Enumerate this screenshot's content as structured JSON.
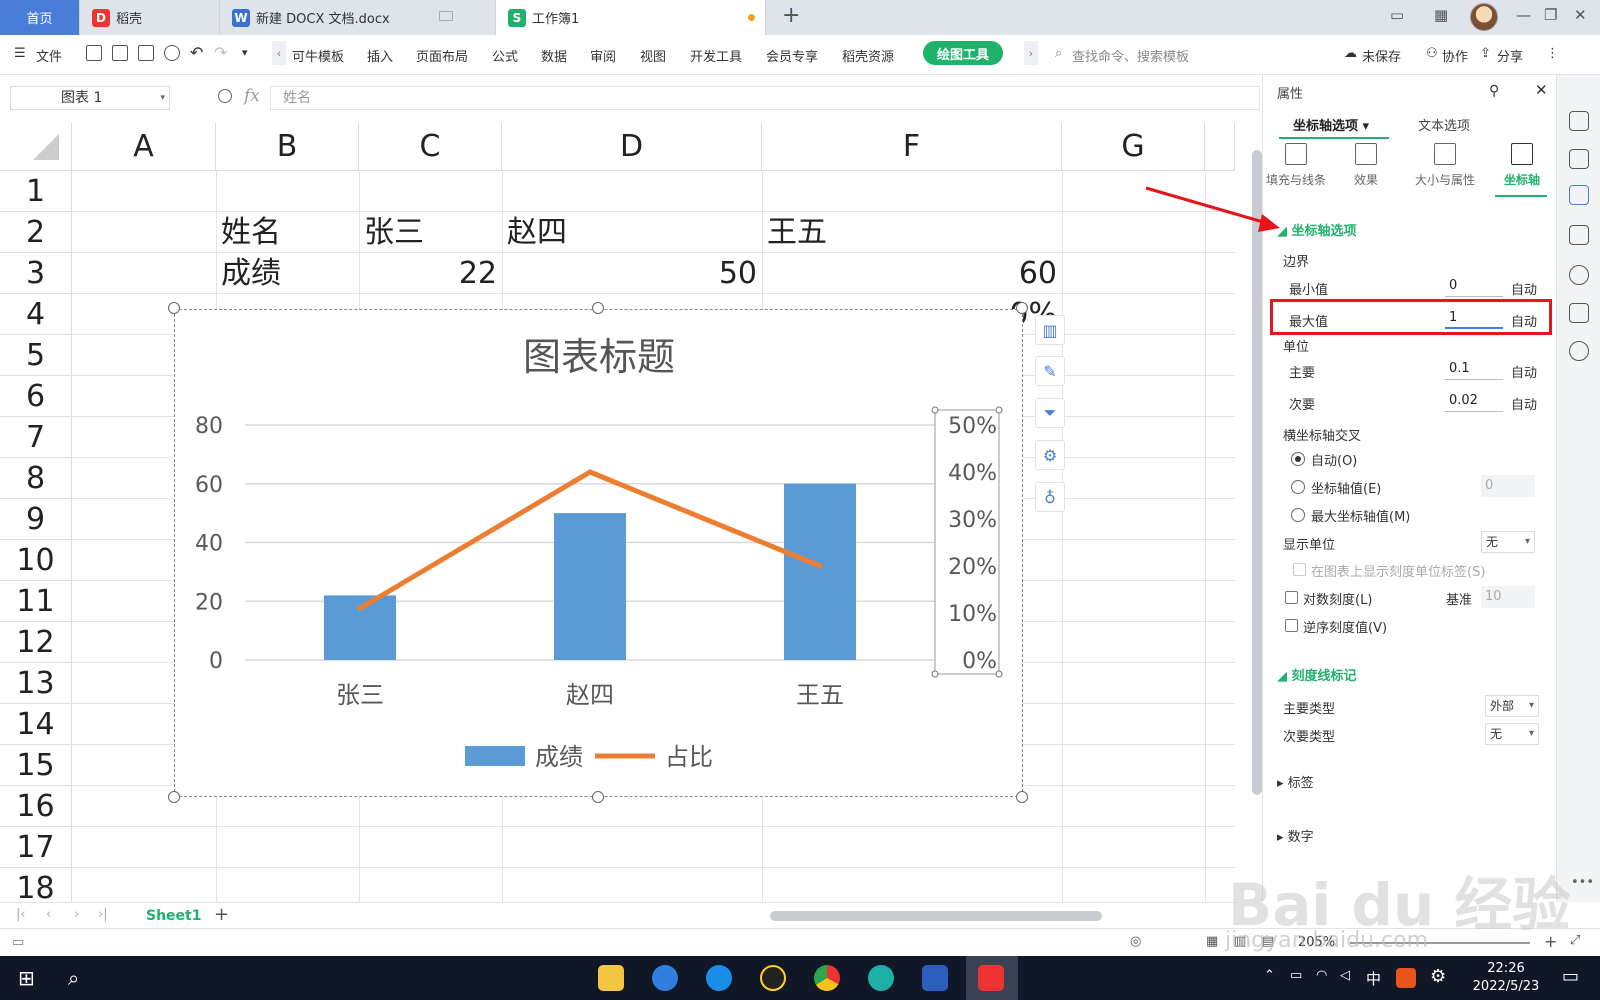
{
  "tabs": {
    "home": "首页",
    "daoke": "稻壳",
    "doc": "新建 DOCX 文档.docx",
    "workbook": "工作簿1"
  },
  "menu": {
    "file": "文件",
    "items": [
      "可牛模板",
      "插入",
      "页面布局",
      "公式",
      "数据",
      "审阅",
      "视图",
      "开发工具",
      "会员专享",
      "稻壳资源"
    ],
    "draw_tools": "绘图工具",
    "search": "查找命令、搜索模板",
    "unsaved": "未保存",
    "collab": "协作",
    "share": "分享"
  },
  "formula": {
    "namebox": "图表 1",
    "fx": "fx",
    "content": "姓名"
  },
  "grid": {
    "columns": [
      "A",
      "B",
      "C",
      "D",
      "F",
      "G"
    ],
    "rows": [
      "1",
      "2",
      "3",
      "4",
      "5",
      "6",
      "7",
      "8",
      "9",
      "10",
      "11",
      "12",
      "13",
      "14",
      "15",
      "16",
      "17",
      "18"
    ],
    "cells": {
      "b2": "姓名",
      "c2": "张三",
      "d2": "赵四",
      "f2": "王五",
      "b3": "成绩",
      "c3": "22",
      "d3": "50",
      "f3": "60",
      "f4_partial": "0%"
    }
  },
  "chart_data": {
    "type": "bar",
    "title": "图表标题",
    "categories": [
      "张三",
      "赵四",
      "王五"
    ],
    "series": [
      {
        "name": "成绩",
        "type": "bar",
        "axis": "left",
        "values": [
          22,
          50,
          60
        ],
        "color": "#5b9bd5"
      },
      {
        "name": "占比",
        "type": "line",
        "axis": "right",
        "values": [
          0.11,
          0.4,
          0.2
        ],
        "color": "#ed7d31"
      }
    ],
    "y_left": {
      "ticks": [
        "80",
        "60",
        "40",
        "20",
        "0"
      ],
      "ylim": [
        0,
        80
      ]
    },
    "y_right": {
      "ticks": [
        "50%",
        "40%",
        "30%",
        "20%",
        "10%",
        "0%"
      ],
      "ylim": [
        0,
        0.5
      ]
    },
    "legend": "bottom",
    "grid": true
  },
  "props": {
    "title": "属性",
    "tab_axis": "坐标轴选项",
    "tab_text": "文本选项",
    "icon_tabs": [
      "填充与线条",
      "效果",
      "大小与属性",
      "坐标轴"
    ],
    "section_axis": "坐标轴选项",
    "bounds": "边界",
    "min_label": "最小值",
    "min_value": "0",
    "max_label": "最大值",
    "max_value": "1",
    "auto": "自动",
    "unit": "单位",
    "major_label": "主要",
    "major_value": "0.1",
    "minor_label": "次要",
    "minor_value": "0.02",
    "cross": "横坐标轴交叉",
    "cross_auto": "自动(O)",
    "cross_value": "坐标轴值(E)",
    "cross_value_input": "0",
    "cross_max": "最大坐标轴值(M)",
    "display_unit": "显示单位",
    "display_unit_value": "无",
    "show_unit_label": "在图表上显示刻度单位标签(S)",
    "log_scale": "对数刻度(L)",
    "base": "基准",
    "base_value": "10",
    "reverse": "逆序刻度值(V)",
    "section_tick": "刻度线标记",
    "major_type": "主要类型",
    "major_type_value": "外部",
    "minor_type": "次要类型",
    "minor_type_value": "无",
    "labels": "标签",
    "number": "数字"
  },
  "sheet": {
    "name": "Sheet1"
  },
  "status": {
    "zoom": "205%"
  },
  "taskbar": {
    "ime": "中",
    "time": "22:26",
    "date": "2022/5/23"
  },
  "watermark": {
    "text": "Bai du 经验",
    "url": "jingyan.baidu.com"
  }
}
